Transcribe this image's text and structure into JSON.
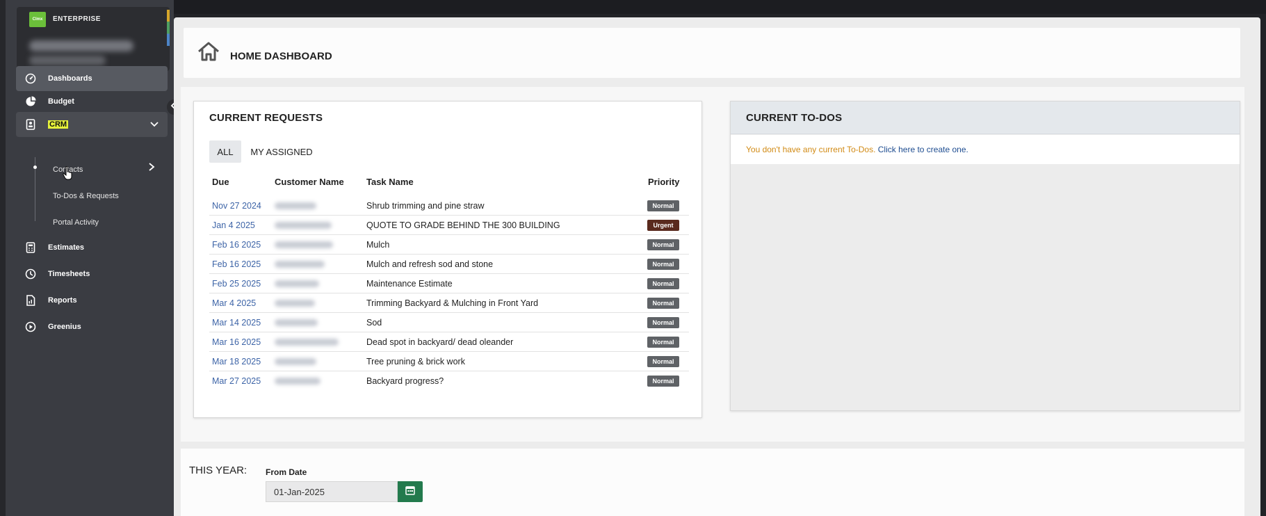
{
  "brand": {
    "logo_text": "Clmx",
    "name": "ENTERPRISE"
  },
  "sidebar": {
    "items": [
      {
        "label": "Dashboards",
        "icon": "dashboard-gauge-icon"
      },
      {
        "label": "Budget",
        "icon": "pie-chart-icon"
      },
      {
        "label": "CRM",
        "icon": "contact-book-icon"
      },
      {
        "label": "Estimates",
        "icon": "calculator-icon"
      },
      {
        "label": "Timesheets",
        "icon": "clock-icon"
      },
      {
        "label": "Reports",
        "icon": "document-chart-icon"
      },
      {
        "label": "Greenius",
        "icon": "play-circle-icon"
      }
    ],
    "crm_sub": [
      {
        "label": "Contacts"
      },
      {
        "label": "To-Dos & Requests"
      },
      {
        "label": "Portal Activity"
      }
    ]
  },
  "header": {
    "title": "HOME DASHBOARD",
    "icon": "home-icon"
  },
  "requests": {
    "title": "CURRENT REQUESTS",
    "tabs": [
      "ALL",
      "MY ASSIGNED"
    ],
    "columns": [
      "Due",
      "Customer Name",
      "Task Name",
      "Priority"
    ],
    "rows": [
      {
        "due": "Nov 27 2024",
        "task": "Shrub trimming and pine straw",
        "priority": "Normal"
      },
      {
        "due": "Jan 4 2025",
        "task": "QUOTE TO GRADE BEHIND THE 300 BUILDING",
        "priority": "Urgent"
      },
      {
        "due": "Feb 16 2025",
        "task": "Mulch",
        "priority": "Normal"
      },
      {
        "due": "Feb 16 2025",
        "task": "Mulch and refresh sod and stone",
        "priority": "Normal"
      },
      {
        "due": "Feb 25 2025",
        "task": "Maintenance Estimate",
        "priority": "Normal"
      },
      {
        "due": "Mar 4 2025",
        "task": "Trimming Backyard & Mulching in Front Yard",
        "priority": "Normal"
      },
      {
        "due": "Mar 14 2025",
        "task": "Sod",
        "priority": "Normal"
      },
      {
        "due": "Mar 16 2025",
        "task": "Dead spot in backyard/ dead oleander",
        "priority": "Normal"
      },
      {
        "due": "Mar 18 2025",
        "task": "Tree pruning & brick work",
        "priority": "Normal"
      },
      {
        "due": "Mar 27 2025",
        "task": "Backyard progress?",
        "priority": "Normal"
      }
    ]
  },
  "todos": {
    "title": "CURRENT TO-DOS",
    "empty_message": "You don't have any current To-Dos.",
    "create_link": "Click here",
    "create_suffix": "to create one."
  },
  "this_year": {
    "label": "THIS YEAR:",
    "from_label": "From Date",
    "from_value": "01-Jan-2025"
  },
  "colors": {
    "sidebar_bg": "#3a3c42",
    "accent_green": "#237a4d",
    "link_blue": "#3d64a7",
    "todo_text": "#d18a14",
    "badge_normal": "#5f6266",
    "badge_urgent": "#5a2a1e",
    "crm_highlight": "#e6f23a"
  }
}
